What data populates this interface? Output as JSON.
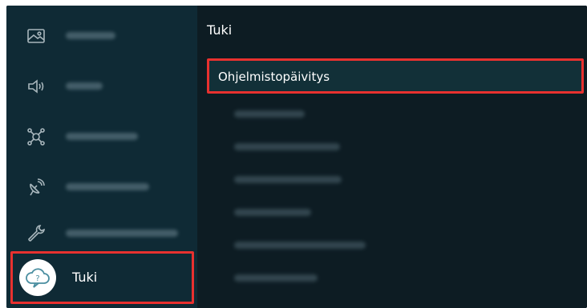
{
  "sidebar": {
    "items": [
      {
        "icon": "picture-icon",
        "label": ""
      },
      {
        "icon": "sound-icon",
        "label": ""
      },
      {
        "icon": "connection-icon",
        "label": ""
      },
      {
        "icon": "broadcasting-icon",
        "label": ""
      },
      {
        "icon": "wrench-icon",
        "label": ""
      },
      {
        "icon": "support-icon",
        "label": "Tuki",
        "selected": true
      }
    ]
  },
  "content": {
    "title": "Tuki",
    "items": [
      {
        "label": "Ohjelmistopäivitys",
        "selected": true
      },
      {
        "label": ""
      },
      {
        "label": ""
      },
      {
        "label": ""
      },
      {
        "label": ""
      },
      {
        "label": ""
      },
      {
        "label": ""
      }
    ]
  },
  "colors": {
    "focus_border": "#e8312f",
    "sidebar_bg": "#0f2a35",
    "content_bg": "#0d1c23",
    "icon_color": "#a8b6bc"
  }
}
